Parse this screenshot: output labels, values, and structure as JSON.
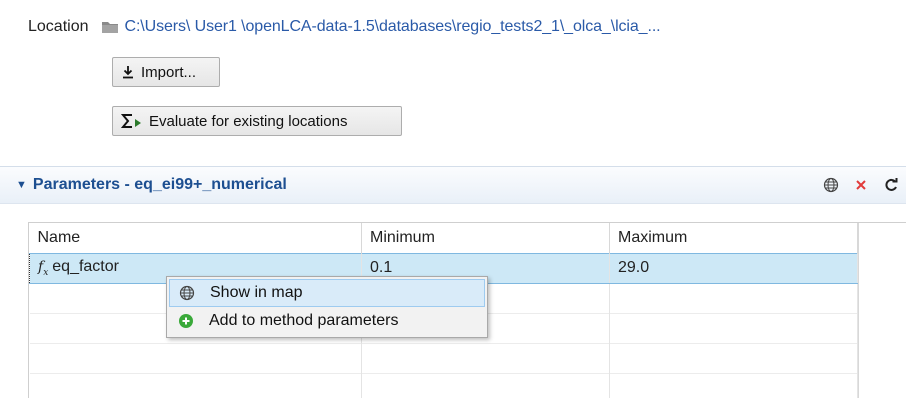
{
  "location": {
    "label": "Location",
    "path": "C:\\Users\\ User1 \\openLCA-data-1.5\\databases\\regio_tests2_1\\_olca_\\lcia_..."
  },
  "buttons": {
    "import_label": "Import...",
    "evaluate_label": "Evaluate for existing locations"
  },
  "section": {
    "title": "Parameters - eq_ei99+_numerical"
  },
  "table": {
    "headers": [
      "Name",
      "Minimum",
      "Maximum"
    ],
    "rows": [
      {
        "name": "eq_factor",
        "minimum": "0.1",
        "maximum": "29.0"
      }
    ]
  },
  "context_menu": {
    "items": [
      {
        "label": "Show in map",
        "icon": "globe-icon"
      },
      {
        "label": "Add to method parameters",
        "icon": "add-circle-icon"
      }
    ]
  },
  "colors": {
    "accent": "#1d4f91",
    "link": "#2a5aa8",
    "selection": "#cde8f6",
    "delete": "#e23b3b",
    "add": "#3aa93a"
  }
}
